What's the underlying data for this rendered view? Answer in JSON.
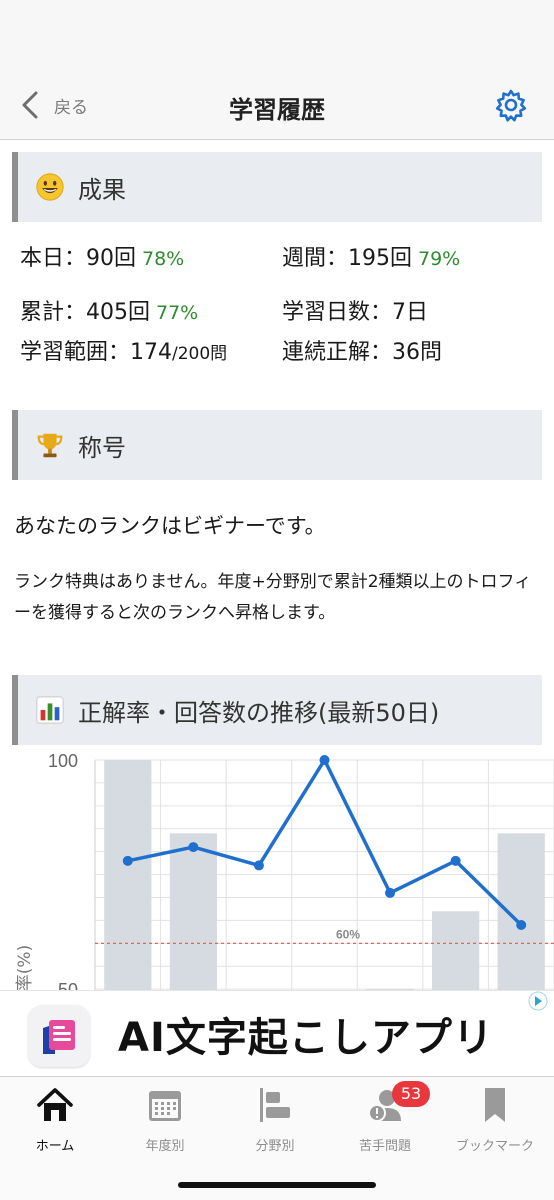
{
  "nav": {
    "back_label": "戻る",
    "title": "学習履歴",
    "settings_icon": "gear-icon"
  },
  "results": {
    "icon": "grinning-face-icon",
    "title": "成果",
    "today_label": "本日：90回",
    "today_pct": "78%",
    "week_label": "週間：195回",
    "week_pct": "79%",
    "total_label": "累計：405回",
    "total_pct": "77%",
    "days_label": "学習日数：7日",
    "range_label": "学習範囲：174",
    "range_suffix": "/200問",
    "streak_label": "連続正解：36問"
  },
  "title_section": {
    "icon": "trophy-icon",
    "title": "称号",
    "rank_text": "あなたのランクはビギナーです。",
    "note": "ランク特典はありません。年度+分野別で累計2種類以上のトロフィーを獲得すると次のランクへ昇格します。"
  },
  "trend_section": {
    "icon": "bar-chart-icon",
    "title": "正解率・回答数の推移(最新50日)"
  },
  "chart_data": {
    "type": "bar",
    "y_ticks": [
      "100",
      "50"
    ],
    "ylabel": "正解率(%)",
    "ylim": [
      40,
      100
    ],
    "reference_line": {
      "value": 60,
      "label": "60%",
      "color": "#e8553a"
    },
    "bar_values": [
      100,
      84,
      null,
      null,
      50,
      67,
      84
    ],
    "line_series": {
      "values": [
        78,
        81,
        77,
        100,
        71,
        78,
        64
      ],
      "color": "#1f6fce"
    },
    "bar_color": "#d5dbe0"
  },
  "ad": {
    "text": "AI文字起こしアプリ",
    "logo_icon": "notes-app-icon",
    "badge_icon": "ad-choices-icon"
  },
  "tabs": [
    {
      "label": "ホーム",
      "icon": "home-icon",
      "active": true
    },
    {
      "label": "年度別",
      "icon": "calendar-icon",
      "active": false
    },
    {
      "label": "分野別",
      "icon": "category-bars-icon",
      "active": false
    },
    {
      "label": "苦手問題",
      "icon": "weak-user-icon",
      "badge": "53",
      "active": false
    },
    {
      "label": "ブックマーク",
      "icon": "bookmark-icon",
      "active": false
    }
  ]
}
